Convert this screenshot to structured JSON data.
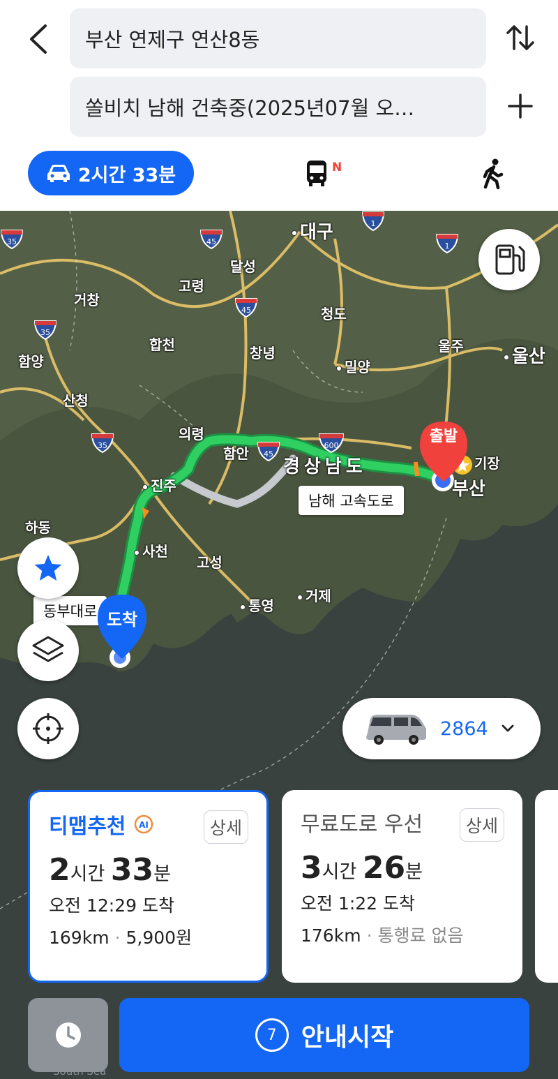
{
  "search": {
    "origin": "부산 연제구 연산8동",
    "destination": "쏠비치 남해 건축중(2025년07월 오…"
  },
  "modes": {
    "car_label": "2시간 33분",
    "bus_badge": "N"
  },
  "map": {
    "places": {
      "daegu": "대구",
      "dalseong": "달성",
      "goryeong": "고령",
      "geochang": "거창",
      "hapcheon": "합천",
      "hamyang": "함양",
      "sancheong": "산청",
      "changnyeong": "창녕",
      "cheongdo": "청도",
      "miryang": "밀양",
      "ulju": "울주",
      "ulsan": "울산",
      "uiryeong": "의령",
      "haman": "함안",
      "gyeongnam": "경상남도",
      "jinju": "진주",
      "hadong": "하동",
      "sacheon": "사천",
      "goseong": "고성",
      "tongyeong": "통영",
      "geoje": "거제",
      "gijang": "기장",
      "busan": "부산",
      "south_sea": "South Sea"
    },
    "highways": [
      "35",
      "45",
      "1",
      "45",
      "45",
      "35",
      "35",
      "45",
      "600",
      "1"
    ],
    "route_labels": {
      "namhae": "남해 고속도로",
      "dongbu": "동부대로"
    },
    "start_label": "출발",
    "end_label": "도착"
  },
  "vehicle": {
    "number": "2864"
  },
  "routes": [
    {
      "title": "티맵추천",
      "ai_badge": "AI",
      "detail": "상세",
      "hours": "2",
      "hours_unit": "시간",
      "minutes": "33",
      "minutes_unit": "분",
      "arrival": "오전 12:29 도착",
      "distance": "169km",
      "toll": "5,900원"
    },
    {
      "title": "무료도로 우선",
      "detail": "상세",
      "hours": "3",
      "hours_unit": "시간",
      "minutes": "26",
      "minutes_unit": "분",
      "arrival": "오전 1:22 도착",
      "distance": "176km",
      "toll": "통행료 없음"
    }
  ],
  "bottom": {
    "countdown": "7",
    "start_label": "안내시작"
  },
  "colors": {
    "accent": "#1466f5",
    "route_green": "#22c25a",
    "start_pin": "#f0413c"
  }
}
